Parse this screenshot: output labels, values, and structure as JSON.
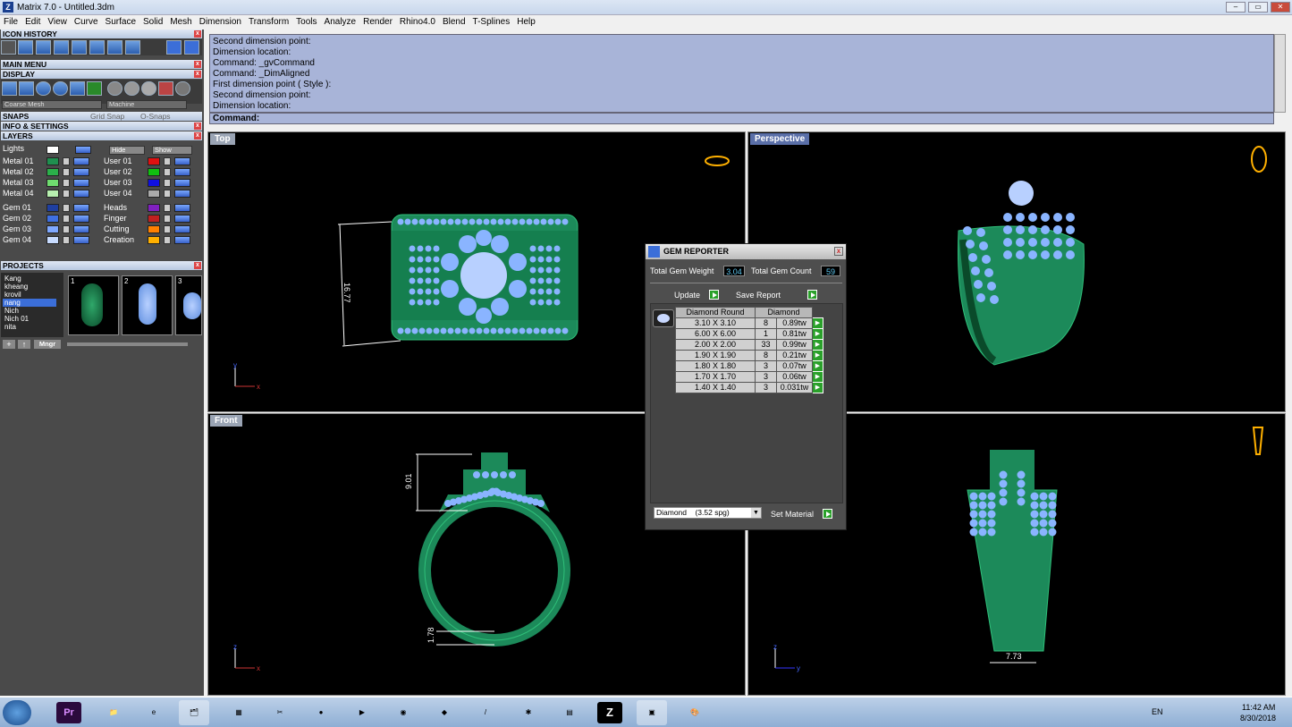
{
  "window": {
    "title": "Matrix 7.0 - Untitled.3dm"
  },
  "menu": [
    "File",
    "Edit",
    "View",
    "Curve",
    "Surface",
    "Solid",
    "Mesh",
    "Dimension",
    "Transform",
    "Tools",
    "Analyze",
    "Render",
    "Rhino4.0",
    "Blend",
    "T-Splines",
    "Help"
  ],
  "panels": {
    "icon_history": "ICON HISTORY",
    "main_menu": "MAIN MENU",
    "display": "DISPLAY",
    "snaps": "SNAPS",
    "grid_snap": "Grid Snap",
    "osnaps": "O-Snaps",
    "info": "INFO & SETTINGS",
    "layers": "LAYERS",
    "projects": "PROJECTS"
  },
  "display": {
    "mesh": "Coarse Mesh",
    "material": "Machine"
  },
  "layers": {
    "lights": "Lights",
    "hide": "Hide",
    "show": "Show",
    "left": [
      {
        "name": "Metal 01",
        "color": "#1f8f4f"
      },
      {
        "name": "Metal 02",
        "color": "#2bb04a"
      },
      {
        "name": "Metal 03",
        "color": "#6fdc6f"
      },
      {
        "name": "Metal 04",
        "color": "#b8f0b0"
      },
      {
        "name": "Gem 01",
        "color": "#1f3fa0"
      },
      {
        "name": "Gem 02",
        "color": "#3f6fe0"
      },
      {
        "name": "Gem 03",
        "color": "#7fa8ff"
      },
      {
        "name": "Gem 04",
        "color": "#c8dcff"
      }
    ],
    "right": [
      {
        "name": "User 01",
        "color": "#e01010"
      },
      {
        "name": "User 02",
        "color": "#10c010"
      },
      {
        "name": "User 03",
        "color": "#1010e0"
      },
      {
        "name": "User 04",
        "color": "#aaaaaa"
      },
      {
        "name": "Heads",
        "color": "#8020c0"
      },
      {
        "name": "Finger",
        "color": "#c02020"
      },
      {
        "name": "Cutting",
        "color": "#ff8000"
      },
      {
        "name": "Creation",
        "color": "#ffb000"
      }
    ]
  },
  "projects": {
    "names": [
      "Kang",
      "kheang",
      "krovil",
      "nang",
      "Nich",
      "Nich 01",
      "nita"
    ],
    "selected": "nang",
    "thumbs": [
      "1",
      "2",
      "3"
    ],
    "mngr": "Mngr"
  },
  "command": {
    "history": [
      "Second dimension point:",
      "Dimension location:",
      "Command: _gvCommand",
      "Command: _DimAligned",
      "First dimension point ( Style ):",
      "Second dimension point:",
      "Dimension location:"
    ],
    "prompt": "Command:"
  },
  "viewports": {
    "top": "Top",
    "perspective": "Perspective",
    "front": "Front",
    "dims": {
      "top": "16.77",
      "front_h": "9.01",
      "front_b": "1.78",
      "right_w": "7.73"
    }
  },
  "gem_reporter": {
    "title": "GEM REPORTER",
    "weight_label": "Total Gem Weight",
    "weight": "3.04",
    "count_label": "Total Gem Count",
    "count": "59",
    "update": "Update",
    "save": "Save Report",
    "col1": "Diamond Round",
    "col2": "Diamond",
    "rows": [
      [
        "3.10 X 3.10",
        "8",
        "0.89tw"
      ],
      [
        "6.00 X 6.00",
        "1",
        "0.81tw"
      ],
      [
        "2.00 X 2.00",
        "33",
        "0.99tw"
      ],
      [
        "1.90 X 1.90",
        "8",
        "0.21tw"
      ],
      [
        "1.80 X 1.80",
        "3",
        "0.07tw"
      ],
      [
        "1.70 X 1.70",
        "3",
        "0.06tw"
      ],
      [
        "1.40 X 1.40",
        "3",
        "0.031tw"
      ]
    ],
    "material": "Diamond    (3.52 spg)",
    "set_material": "Set Material"
  },
  "taskbar": {
    "lang": "EN",
    "time": "11:42 AM",
    "date": "8/30/2018",
    "apps": [
      "Pr",
      "Z"
    ]
  }
}
